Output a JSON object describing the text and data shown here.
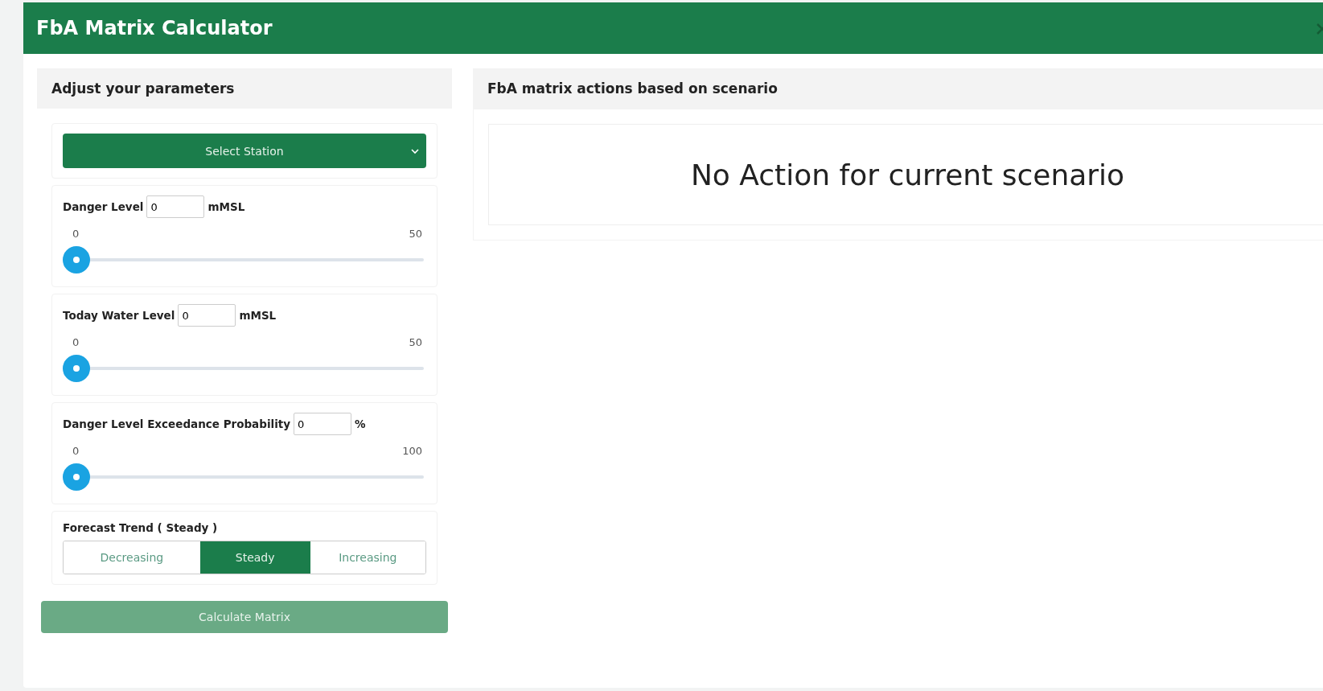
{
  "window": {
    "title": "FbA Matrix Calculator"
  },
  "parameters": {
    "title": "Adjust your parameters",
    "station": {
      "label": "Select Station"
    },
    "sliders": [
      {
        "label": "Danger Level",
        "value": "0",
        "unit": "mMSL",
        "min": "0",
        "max": "50",
        "level": 0
      },
      {
        "label": "Today Water Level",
        "value": "0",
        "unit": "mMSL",
        "min": "0",
        "max": "50",
        "level": 0
      },
      {
        "label": "Danger Level Exceedance Probability",
        "value": "0",
        "unit": "%",
        "min": "0",
        "max": "100",
        "level": 0
      }
    ],
    "trend": {
      "label": "Forecast Trend ( Steady )",
      "options": [
        {
          "label": "Decreasing",
          "selected": false
        },
        {
          "label": "Steady",
          "selected": true
        },
        {
          "label": "Increasing",
          "selected": false
        }
      ]
    },
    "calculate": {
      "label": "Calculate Matrix",
      "disabled": true
    }
  },
  "actions": {
    "title": "FbA matrix actions based on scenario",
    "message": "No Action for current scenario"
  }
}
